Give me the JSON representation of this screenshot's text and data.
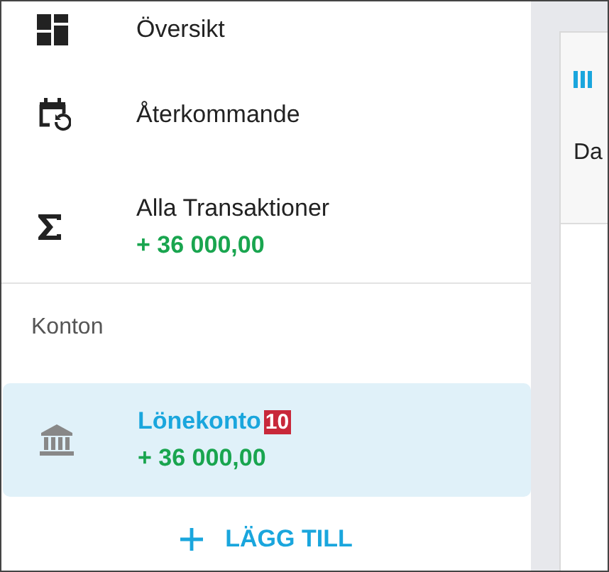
{
  "nav": [
    {
      "kind": "dashboard",
      "label": "Översikt",
      "selected": false
    },
    {
      "kind": "recurring",
      "label": "Återkommande",
      "selected": false
    },
    {
      "kind": "sum",
      "label": "Alla Transaktioner",
      "amount": "+ 36 000,00",
      "selected": false
    }
  ],
  "accounts_heading": "Konton",
  "accounts": [
    {
      "name": "Lönekonto",
      "badge": "10",
      "amount": "+ 36 000,00",
      "selected": true
    }
  ],
  "add_button": "LÄGG TILL",
  "main": {
    "column_1": "Da"
  }
}
